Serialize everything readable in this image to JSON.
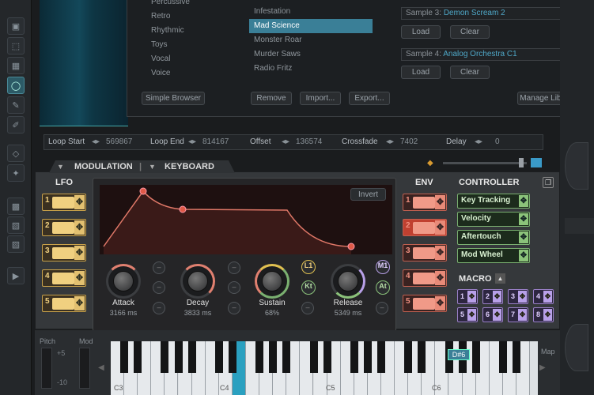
{
  "browser": {
    "categories": [
      "Percussive",
      "Retro",
      "Rhythmic",
      "Toys",
      "Vocal",
      "Voice"
    ],
    "presets": [
      "Infestation",
      "Mad Science",
      "Monster Roar",
      "Murder Saws",
      "Radio Fritz"
    ],
    "selected_preset": "Mad Science",
    "buttons": {
      "simple_browser": "Simple Browser",
      "remove": "Remove",
      "import": "Import...",
      "export": "Export...",
      "manage_library": "Manage Library"
    },
    "samples": [
      {
        "label": "Sample 3:",
        "name": "Demon Scream 2",
        "load": "Load",
        "clear": "Clear"
      },
      {
        "label": "Sample 4:",
        "name": "Analog Orchestra C1",
        "load": "Load",
        "clear": "Clear"
      }
    ]
  },
  "loop": {
    "loop_start_label": "Loop Start",
    "loop_start": "569867",
    "loop_end_label": "Loop End",
    "loop_end": "814167",
    "offset_label": "Offset",
    "offset": "136574",
    "crossfade_label": "Crossfade",
    "crossfade": "7402",
    "delay_label": "Delay",
    "delay": "0"
  },
  "tabs": {
    "modulation": "MODULATION",
    "keyboard": "KEYBOARD"
  },
  "sections": {
    "lfo": "LFO",
    "env": "ENV",
    "controller": "CONTROLLER",
    "macro": "MACRO"
  },
  "lfo_numbers": [
    "1",
    "2",
    "3",
    "4",
    "5"
  ],
  "env_numbers": [
    "1",
    "2",
    "3",
    "4",
    "5"
  ],
  "invert_label": "Invert",
  "knobs": [
    {
      "label": "Attack",
      "value": "3166 ms"
    },
    {
      "label": "Decay",
      "value": "3833 ms"
    },
    {
      "label": "Sustain",
      "value": "68%"
    },
    {
      "label": "Release",
      "value": "5349 ms"
    }
  ],
  "knob_badges": {
    "l1": "L1",
    "kt": "Kt",
    "m1": "M1",
    "at": "At"
  },
  "controllers": [
    "Key Tracking",
    "Velocity",
    "Aftertouch",
    "Mod Wheel"
  ],
  "macros": [
    "1",
    "2",
    "3",
    "4",
    "5",
    "6",
    "7",
    "8"
  ],
  "keyboard": {
    "pitch_label": "Pitch",
    "mod_label": "Mod",
    "map_label": "Map",
    "note_badge": "D#6",
    "octaves": [
      "C3",
      "C4",
      "C5",
      "C6"
    ],
    "pitch_plus": "+5",
    "pitch_minus": "-10"
  },
  "colors": {
    "lfo": "#d8b058",
    "env": "#e07868",
    "controller": "#8bc27a",
    "macro": "#b8a0e8",
    "accent": "#3a7f97"
  }
}
